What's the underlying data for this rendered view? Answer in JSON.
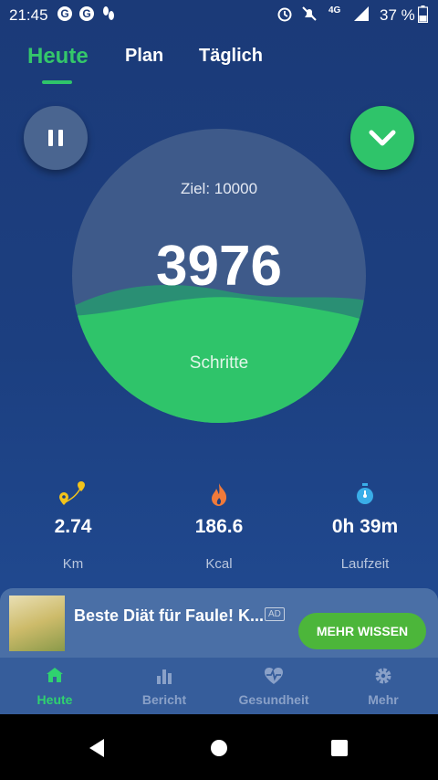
{
  "status_bar": {
    "time": "21:45",
    "notification_icons": [
      "google-icon",
      "google-icon",
      "steps-icon"
    ],
    "battery_percent": "37 %",
    "network_label": "4G"
  },
  "tabs": [
    {
      "label": "Heute",
      "active": true
    },
    {
      "label": "Plan",
      "active": false
    },
    {
      "label": "Täglich",
      "active": false
    }
  ],
  "counter": {
    "goal_text": "Ziel: 10000",
    "steps_value": "3976",
    "steps_label": "Schritte",
    "progress": 0.3976
  },
  "stats": [
    {
      "icon": "distance-pin-icon",
      "value": "2.74",
      "label": "Km"
    },
    {
      "icon": "flame-icon",
      "value": "186.6",
      "label": "Kcal"
    },
    {
      "icon": "stopwatch-icon",
      "value": "0h 39m",
      "label": "Laufzeit"
    }
  ],
  "ad": {
    "title": "Beste Diät für Faule! K...",
    "badge": "AD",
    "button_label": "MEHR WISSEN"
  },
  "bottom_nav": [
    {
      "icon": "home-icon",
      "label": "Heute",
      "active": true
    },
    {
      "icon": "bar-chart-icon",
      "label": "Bericht",
      "active": false
    },
    {
      "icon": "heart-pulse-icon",
      "label": "Gesundheit",
      "active": false
    },
    {
      "icon": "gear-icon",
      "label": "Mehr",
      "active": false
    }
  ],
  "colors": {
    "accent": "#2fc46a",
    "background_top": "#1b3a78",
    "ad_button": "#4cb63a"
  }
}
